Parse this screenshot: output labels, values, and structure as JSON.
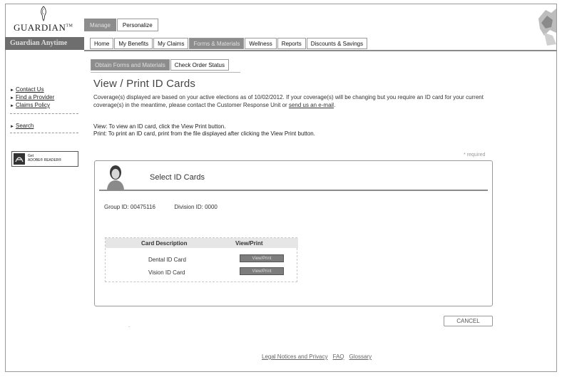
{
  "logo": {
    "name": "GUARDIAN",
    "mark": "TM"
  },
  "brand_bar": "Guardian Anytime",
  "top_nav": [
    {
      "label": "Manage",
      "active": true
    },
    {
      "label": "Personalize",
      "active": false
    }
  ],
  "main_nav": [
    {
      "label": "Home",
      "active": false
    },
    {
      "label": "My Benefits",
      "active": false
    },
    {
      "label": "My Claims",
      "active": false
    },
    {
      "label": "Forms & Materials",
      "active": true
    },
    {
      "label": "Wellness",
      "active": false
    },
    {
      "label": "Reports",
      "active": false
    },
    {
      "label": "Discounts & Savings",
      "active": false
    }
  ],
  "sub_nav": [
    {
      "label": "Obtain Forms and Materials",
      "active": true
    },
    {
      "label": "Check Order Status",
      "active": false
    }
  ],
  "sidebar": {
    "links": [
      "Contact Us",
      "Find a Provider",
      "Claims Policy"
    ],
    "search": "Search",
    "reader": {
      "line1": "Get",
      "line2": "ADOBE® READER®"
    }
  },
  "page": {
    "title": "View / Print ID Cards",
    "coverage_text": "Coverage(s) displayed are based on your active elections as of 10/02/2012. If your coverage(s) will be changing but you require an ID card for your current coverage(s) in the meantime, please contact the Customer Response Unit or ",
    "email_link": "send us an e-mail",
    "coverage_end": ".",
    "view_instr": "View: To view an ID card, click the View Print button.",
    "print_instr": "Print: To print an ID card, print from the file displayed after clicking the View Print button.",
    "required": "* required"
  },
  "panel": {
    "title": "Select ID Cards",
    "group_id_label": "Group ID:",
    "group_id": "00475116",
    "division_id_label": "Division ID:",
    "division_id": "0000",
    "table": {
      "col_desc": "Card Description",
      "col_view": "View/Print",
      "rows": [
        {
          "desc": "Dental ID Card",
          "button": "View/Print"
        },
        {
          "desc": "Vision ID Card",
          "button": "View/Print"
        }
      ]
    }
  },
  "cancel_label": "CANCEL",
  "footer": {
    "legal": "Legal Notices and Privacy",
    "faq": "FAQ",
    "glossary": "Glossary"
  }
}
